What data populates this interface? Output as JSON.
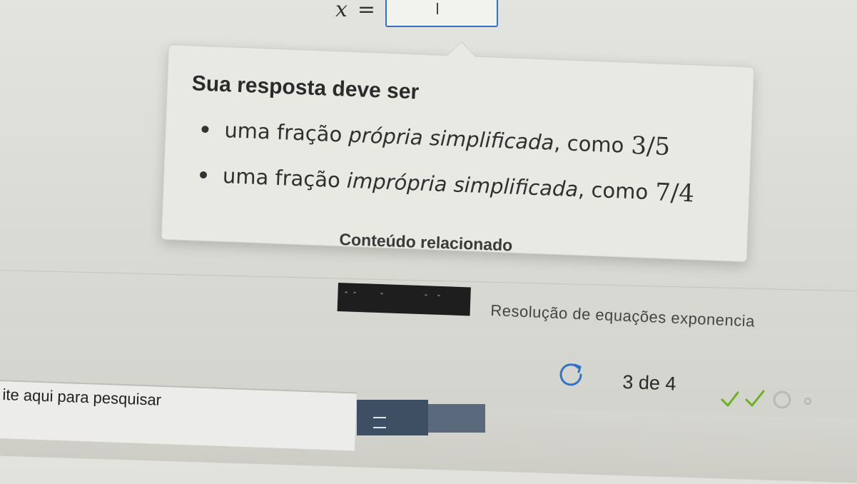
{
  "answer": {
    "variable": "x",
    "equals": "=",
    "value": ""
  },
  "hint": {
    "title": "Sua resposta deve ser",
    "items": [
      {
        "prefix": "uma fração ",
        "emphasis": "própria simplificada",
        "suffix": ", como",
        "example": "3/5"
      },
      {
        "prefix": "uma fração ",
        "emphasis": "imprópria simplificada",
        "suffix": ", como",
        "example": "7/4"
      }
    ]
  },
  "related": {
    "heading": "Conteúdo relacionado",
    "video_title": "Resolução de equações exponencia"
  },
  "progress": {
    "text": "3 de 4",
    "current": 3,
    "total": 4,
    "completed": 2
  },
  "taskbar": {
    "search_placeholder": "ite aqui para pesquisar"
  },
  "colors": {
    "accent": "#2f73c6",
    "check": "#6ab023",
    "pending": "#b8b8b8"
  },
  "icons": {
    "retry": "retry-icon",
    "task_view": "task-view-icon"
  }
}
